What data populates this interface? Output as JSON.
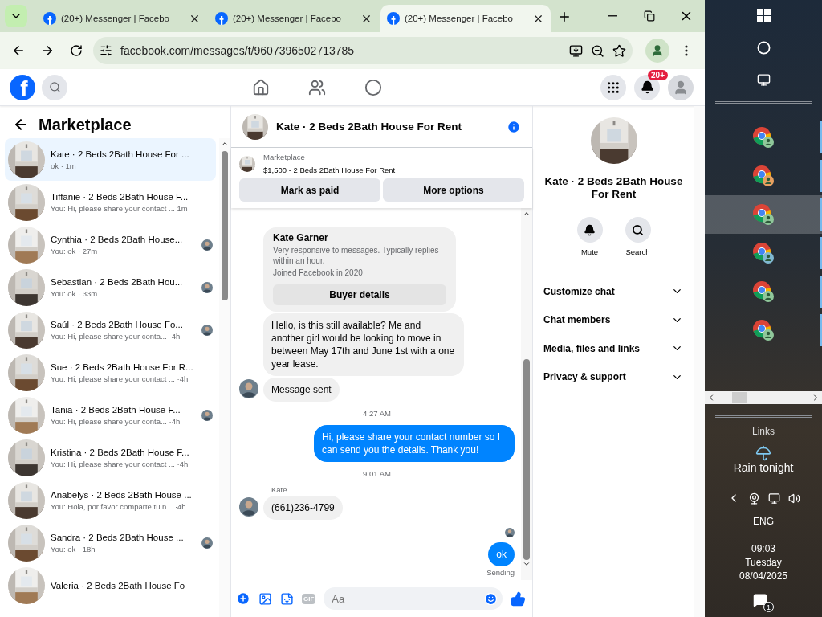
{
  "browser": {
    "tabs": [
      {
        "title": "(20+) Messenger | Facebo",
        "selected": false
      },
      {
        "title": "(20+) Messenger | Facebo",
        "selected": false
      },
      {
        "title": "(20+) Messenger | Facebo",
        "selected": true
      }
    ],
    "address": "facebook.com/messages/t/9607396502713785"
  },
  "header": {
    "logo": "f",
    "notifications_badge": "20+"
  },
  "sidebar": {
    "title": "Marketplace",
    "conversations": [
      {
        "name": "Kate · 2 Beds 2Bath House For ...",
        "preview": "ok · 1m",
        "selected": true,
        "seen": false
      },
      {
        "name": "Tiffanie · 2 Beds 2Bath House F...",
        "preview": "You: Hi, please share your contact ...  1m",
        "selected": false,
        "seen": false
      },
      {
        "name": "Cynthia · 2 Beds 2Bath House...",
        "preview": "You: ok · 27m",
        "selected": false,
        "seen": true
      },
      {
        "name": "Sebastian · 2 Beds 2Bath Hou...",
        "preview": "You: ok · 33m",
        "selected": false,
        "seen": true
      },
      {
        "name": "Saúl · 2 Beds 2Bath House Fo...",
        "preview": "You: Hi, please share your conta... ·4h",
        "selected": false,
        "seen": true
      },
      {
        "name": "Sue · 2 Beds 2Bath House For R...",
        "preview": "You: Hi, please share your contact ...  ·4h",
        "selected": false,
        "seen": false
      },
      {
        "name": "Tania · 2 Beds 2Bath House F...",
        "preview": "You: Hi, please share your conta... ·4h",
        "selected": false,
        "seen": true
      },
      {
        "name": "Kristina · 2 Beds 2Bath House F...",
        "preview": "You: Hi, please share your contact ...  ·4h",
        "selected": false,
        "seen": false
      },
      {
        "name": "Anabelys · 2 Beds 2Bath House ...",
        "preview": "You: Hola, por favor comparte tu n... ·4h",
        "selected": false,
        "seen": false
      },
      {
        "name": "Sandra · 2 Beds 2Bath House ...",
        "preview": "You: ok · 18h",
        "selected": false,
        "seen": true
      },
      {
        "name": "Valeria · 2 Beds 2Bath House Fo",
        "selected": false,
        "seen": false
      }
    ]
  },
  "chat": {
    "title": "Kate · 2 Beds 2Bath House For Rent",
    "listing": {
      "label": "Marketplace",
      "price": "$1,500 - 2 Beds 2Bath House For Rent",
      "buttons": [
        "Mark as paid",
        "More options"
      ]
    },
    "messages": [
      {
        "kind": "profile",
        "name": "Kate Garner",
        "lines": [
          "Very responsive to messages. Typically replies within an hour.",
          "Joined Facebook in 2020"
        ],
        "button": "Buyer details"
      },
      {
        "kind": "incoming",
        "text": "Hello, is this still available? Me and another girl would be looking to move in between May 17th and June 1st with a one year lease.",
        "avatar": false
      },
      {
        "kind": "incoming",
        "text": "Message sent",
        "avatar": true
      },
      {
        "kind": "timestamp",
        "text": "4:27 AM"
      },
      {
        "kind": "outgoing",
        "text": "Hi, please share your contact number so I can send you the details. Thank you!"
      },
      {
        "kind": "timestamp",
        "text": "9:01 AM"
      },
      {
        "kind": "incoming",
        "sender": "Kate",
        "text": "(661)236-4799",
        "avatar": true
      },
      {
        "kind": "seen"
      },
      {
        "kind": "outgoing",
        "text": "ok",
        "status": "Sending"
      }
    ],
    "composer": {
      "gif": "GIF",
      "placeholder": "Aa"
    }
  },
  "details": {
    "title": "Kate · 2 Beds 2Bath House For Rent",
    "actions": [
      {
        "kind": "mute",
        "label": "Mute"
      },
      {
        "kind": "search",
        "label": "Search"
      }
    ],
    "sections": [
      {
        "label": "Customize chat",
        "expanded": false
      },
      {
        "label": "Chat members",
        "expanded": false
      },
      {
        "label": "Media, files and links",
        "expanded": false
      },
      {
        "label": "Privacy & support",
        "expanded": false
      }
    ]
  },
  "taskbar": {
    "apps": [
      {
        "selected": false,
        "color": "#8fc79a"
      },
      {
        "selected": false,
        "color": "#e8a060"
      },
      {
        "selected": true,
        "color": "#8fc79a"
      },
      {
        "selected": false,
        "color": "#7fb8d0"
      },
      {
        "selected": false,
        "color": "#8fc79a"
      },
      {
        "selected": false,
        "color": "#8fc79a"
      }
    ],
    "links": "Links",
    "weather": "Rain tonight",
    "language": "ENG",
    "time": "09:03",
    "day": "Tuesday",
    "date": "08/04/2025",
    "notifications": "1"
  }
}
